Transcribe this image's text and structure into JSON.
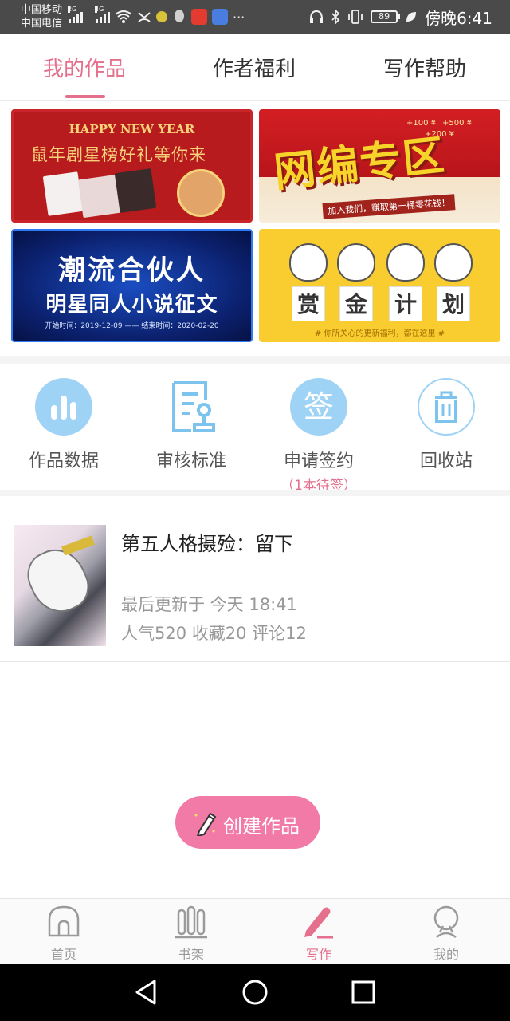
{
  "status_bar": {
    "carrier1": "中国移动",
    "carrier2": "中国电信",
    "net1": "2G",
    "net2": "4G",
    "battery": "89",
    "time": "傍晚6:41"
  },
  "tabs": [
    {
      "label": "我的作品"
    },
    {
      "label": "作者福利"
    },
    {
      "label": "写作帮助"
    }
  ],
  "banners": {
    "b1": {
      "heading": "HAPPY NEW YEAR",
      "slogan": "鼠年剧星榜好礼等你来"
    },
    "b2": {
      "title": "网编专区",
      "subtitle": "加入我们，赚取第一桶零花钱！",
      "coin1": "+100 ¥",
      "coin2": "+500 ¥",
      "coin3": "+200 ¥"
    },
    "b3": {
      "line1": "潮流合伙人",
      "line2": "明星同人小说征文",
      "dates": "开始时间：2019-12-09 —— 结束时间：2020-02-20"
    },
    "b4": {
      "chars": [
        "赏",
        "金",
        "计",
        "划"
      ],
      "note": "# 你所关心的更新福利，都在这里 #"
    }
  },
  "actions": [
    {
      "label": "作品数据",
      "icon": "bar-chart-icon"
    },
    {
      "label": "审核标准",
      "icon": "document-stamp-icon"
    },
    {
      "label": "申请签约",
      "icon": "sign-icon",
      "glyph": "签",
      "sub": "（1本待签）"
    },
    {
      "label": "回收站",
      "icon": "trash-icon"
    }
  ],
  "work": {
    "title": "第五人格摄殓：留下",
    "updated": "最后更新于 今天 18:41",
    "stats": "人气520 收藏20 评论12"
  },
  "create_button": {
    "label": "创建作品"
  },
  "bottom_nav": [
    {
      "label": "首页",
      "icon": "home-icon"
    },
    {
      "label": "书架",
      "icon": "bookshelf-icon"
    },
    {
      "label": "写作",
      "icon": "pen-icon",
      "active": true
    },
    {
      "label": "我的",
      "icon": "profile-icon"
    }
  ],
  "colors": {
    "accent": "#e5708e",
    "button": "#f27aa6",
    "icon_blue": "#9fd3f5"
  }
}
